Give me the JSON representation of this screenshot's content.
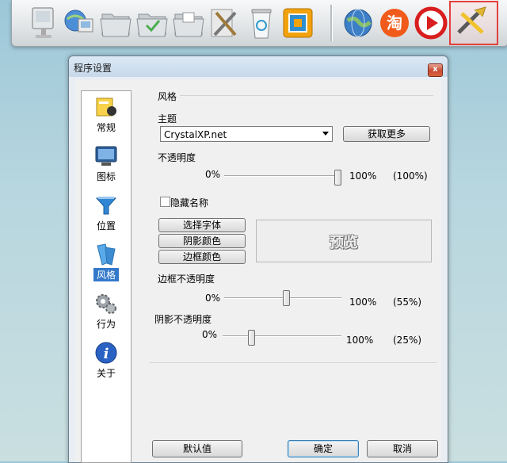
{
  "window": {
    "title": "程序设置",
    "close": "x"
  },
  "sidebar": {
    "items": [
      {
        "label": "常规",
        "icon": "general-icon"
      },
      {
        "label": "图标",
        "icon": "monitor-icon"
      },
      {
        "label": "位置",
        "icon": "position-icon"
      },
      {
        "label": "风格",
        "icon": "style-icon"
      },
      {
        "label": "行为",
        "icon": "gears-icon"
      },
      {
        "label": "关于",
        "icon": "info-icon"
      }
    ],
    "selected_index": 3
  },
  "style": {
    "group_title": "风格",
    "theme_label": "主题",
    "theme_value": "CrystalXP.net",
    "get_more_label": "获取更多",
    "opacity_label": "不透明度",
    "opacity_min": "0%",
    "opacity_max": "100%",
    "opacity_value": "(100%)",
    "opacity_percent": 100,
    "hide_name_label": "隐藏名称",
    "hide_name_checked": false,
    "font_button": "选择字体",
    "shadow_color_button": "阴影颜色",
    "border_color_button": "边框颜色",
    "preview_text": "预览",
    "border_opacity_label": "边框不透明度",
    "border_opacity_min": "0%",
    "border_opacity_max": "100%",
    "border_opacity_value": "(55%)",
    "border_opacity_percent": 55,
    "shadow_opacity_label": "阴影不透明度",
    "shadow_opacity_min": "0%",
    "shadow_opacity_max": "100%",
    "shadow_opacity_value": "(25%)",
    "shadow_opacity_percent": 25
  },
  "footer": {
    "default_label": "默认值",
    "ok_label": "确定",
    "cancel_label": "取消"
  },
  "dock": {
    "icons": [
      "computer-icon",
      "network-icon",
      "folder-icon",
      "folder-icon",
      "folder-icon",
      "tools-icon",
      "recycle-bin-icon",
      "window-icon",
      "globe-icon",
      "taobao-icon",
      "media-player-icon",
      "settings-tools-icon"
    ],
    "taobao_text": "淘"
  },
  "colors": {
    "accent": "#3378c9",
    "highlight": "#e2403e",
    "title_bar": "#c7d9ea"
  }
}
